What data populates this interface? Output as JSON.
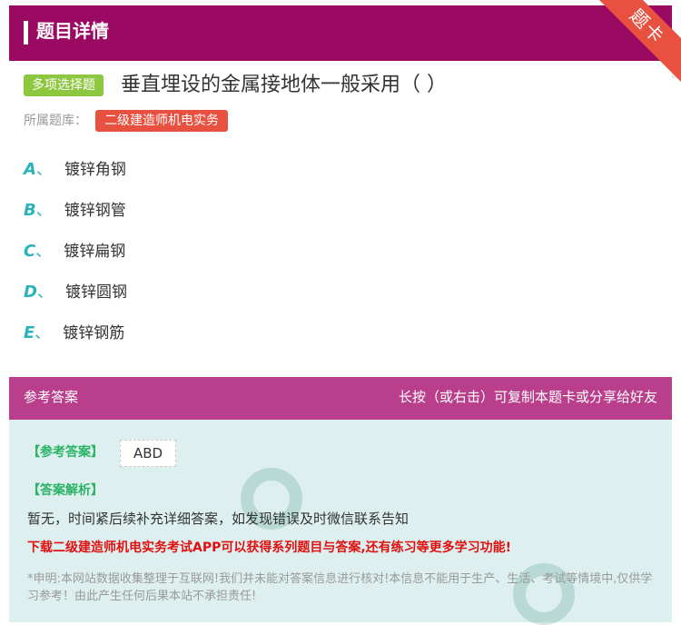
{
  "header": {
    "title": "题目详情",
    "corner_ribbon": "题卡"
  },
  "question": {
    "type_badge": "多项选择题",
    "text": "垂直埋设的金属接地体一般采用（   ）",
    "bank_label": "所属题库：",
    "bank_name": "二级建造师机电实务"
  },
  "options": [
    {
      "letter": "A",
      "sep": "、",
      "text": "镀锌角钢"
    },
    {
      "letter": "B",
      "sep": "、",
      "text": "镀锌钢管"
    },
    {
      "letter": "C",
      "sep": "、",
      "text": "镀锌扁钢"
    },
    {
      "letter": "D",
      "sep": "、",
      "text": "镀锌圆钢"
    },
    {
      "letter": "E",
      "sep": "、",
      "text": "镀锌钢筋"
    }
  ],
  "answer": {
    "header_left": "参考答案",
    "header_right": "长按（或右击）可复制本题卡或分享给好友",
    "answer_label": "【参考答案】",
    "answer_value": "ABD",
    "analysis_label": "【答案解析】",
    "analysis_text": "暂无，时间紧后续补充详细答案，如发现错误及时微信联系告知",
    "promo": "下载二级建造师机电实务考试APP可以获得系列题目与答案,还有练习等更多学习功能!",
    "disclaimer": "*申明:本网站数据收集整理于互联网!我们并未能对答案信息进行核对!本信息不能用于生产、生活、考试等情境中,仅供学习参考！由此产生任何后果本站不承担责任!"
  },
  "colors": {
    "header_bg": "#9a0a62",
    "ribbon": "#e8513f",
    "badge_green": "#8dc63f",
    "option_letter": "#2ab3b8",
    "answer_header": "#b93f8c",
    "answer_bg": "#ddf0ef",
    "promo": "#e01010"
  }
}
